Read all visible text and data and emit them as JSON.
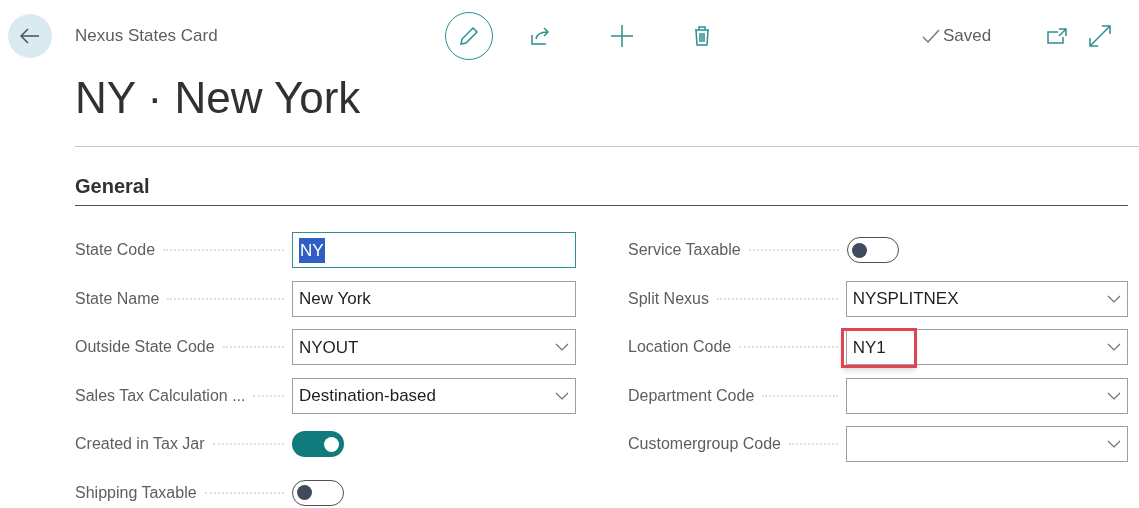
{
  "header": {
    "breadcrumb": "Nexus States Card",
    "status": "Saved"
  },
  "title": "NY · New York",
  "section": {
    "title": "General",
    "columns": [
      [
        {
          "label": "State Code",
          "kind": "text",
          "value": "NY",
          "focused": true,
          "highlighted": false
        },
        {
          "label": "State Name",
          "kind": "text",
          "value": "New York",
          "focused": false,
          "highlighted": false
        },
        {
          "label": "Outside State Code",
          "kind": "select",
          "value": "NYOUT",
          "focused": false,
          "highlighted": false
        },
        {
          "label": "Sales Tax Calculation ...",
          "kind": "select",
          "value": "Destination-based",
          "focused": false,
          "highlighted": false
        },
        {
          "label": "Created in Tax Jar",
          "kind": "toggle",
          "on": true
        },
        {
          "label": "Shipping Taxable",
          "kind": "toggle",
          "on": false
        }
      ],
      [
        {
          "label": "Service Taxable",
          "kind": "toggle",
          "on": false
        },
        {
          "label": "Split Nexus",
          "kind": "select",
          "value": "NYSPLITNEX",
          "focused": false,
          "highlighted": false
        },
        {
          "label": "Location Code",
          "kind": "select",
          "value": "NY1",
          "focused": false,
          "highlighted": true
        },
        {
          "label": "Department Code",
          "kind": "select",
          "focused": false,
          "highlighted": false
        },
        {
          "label": "Customergroup Code",
          "kind": "select",
          "focused": false,
          "highlighted": false
        }
      ]
    ]
  }
}
